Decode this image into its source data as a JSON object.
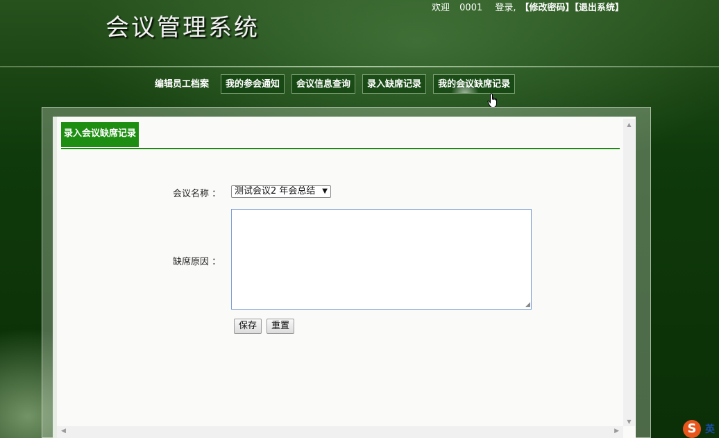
{
  "header": {
    "title": "会议管理系统",
    "welcome": "欢迎",
    "user_id": "0001",
    "login_text": "登录,",
    "change_password": "【修改密码】",
    "logout": "【退出系统】"
  },
  "nav": {
    "items": [
      {
        "label": "编辑员工档案"
      },
      {
        "label": "我的参会通知"
      },
      {
        "label": "会议信息查询"
      },
      {
        "label": "录入缺席记录"
      },
      {
        "label": "我的会议缺席记录"
      }
    ]
  },
  "panel": {
    "tab_label": "录入会议缺席记录"
  },
  "form": {
    "meeting_label": "会议名称 ：",
    "meeting_selected": "测试会议2 年会总结",
    "reason_label": "缺席原因 ：",
    "reason_value": "",
    "save_label": "保存",
    "reset_label": "重置"
  },
  "ime": {
    "logo": "S",
    "mode": "英"
  },
  "colors": {
    "accent_green": "#1d8e11",
    "nav_border": "#7ea073"
  }
}
